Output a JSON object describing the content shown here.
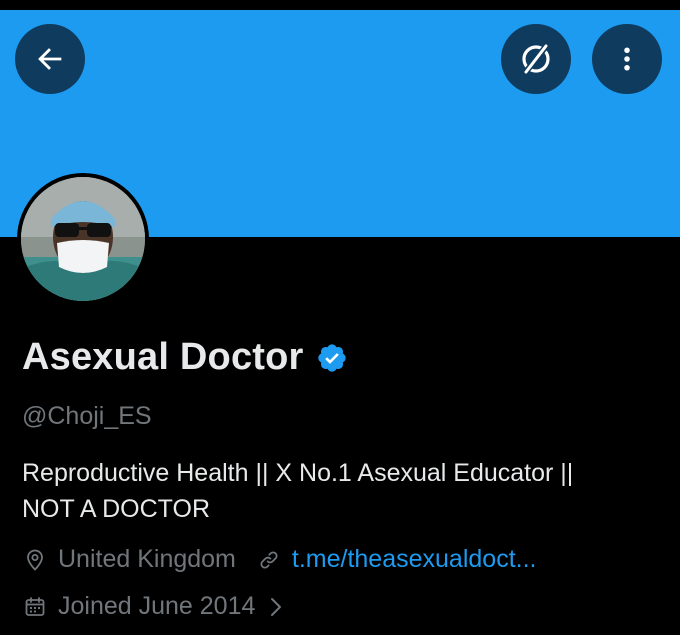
{
  "profile": {
    "display_name": "Asexual Doctor",
    "handle": "@Choji_ES",
    "verified": true,
    "bio_line1": "Reproductive Health || X No.1 Asexual Educator ||",
    "bio_line2": "NOT A DOCTOR",
    "location": "United Kingdom",
    "website": "t.me/theasexualdoct...",
    "joined": "Joined June 2014"
  },
  "icons": {
    "back": "arrow-left-icon",
    "grok": "grok-icon",
    "more": "more-vertical-icon",
    "verified": "verified-badge-icon",
    "location": "location-pin-icon",
    "link": "link-icon",
    "calendar": "calendar-icon",
    "chevron": "chevron-right-icon"
  },
  "colors": {
    "banner": "#1d9bf0",
    "background": "#000000",
    "button_bg": "#0f3b5f",
    "primary_text": "#e7e9ea",
    "secondary_text": "#71767b",
    "link": "#1d9bf0",
    "verified": "#1d9bf0"
  }
}
